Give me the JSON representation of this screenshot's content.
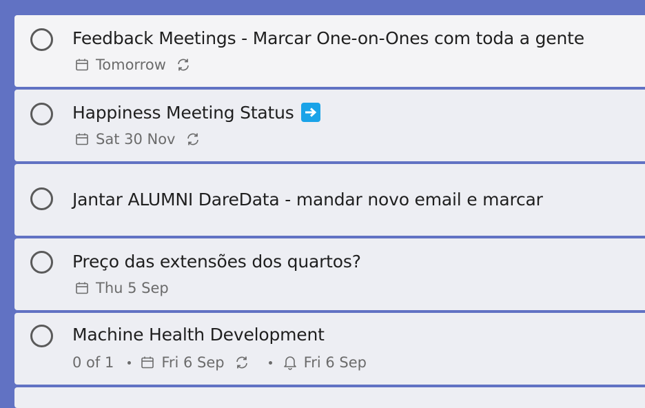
{
  "tasks": [
    {
      "title": "Feedback Meetings - Marcar One-on-Ones com toda a gente",
      "due": "Tomorrow",
      "repeat": true
    },
    {
      "title": "Happiness Meeting Status",
      "emoji": "arrow-right-icon",
      "due": "Sat 30 Nov",
      "repeat": true
    },
    {
      "title": "Jantar ALUMNI DareData - mandar novo email e marcar"
    },
    {
      "title": "Preço das extensões dos quartos?",
      "due": "Thu 5 Sep"
    },
    {
      "title": "Machine Health Development",
      "steps": "0 of 1",
      "due": "Fri 6 Sep",
      "repeat": true,
      "reminder": "Fri 6 Sep"
    }
  ],
  "colors": {
    "background": "#6172c3",
    "card": "#edeef3",
    "text": "#1f1f1f",
    "meta": "#6b6b6b",
    "emoji_badge": "#1aa3e8"
  }
}
